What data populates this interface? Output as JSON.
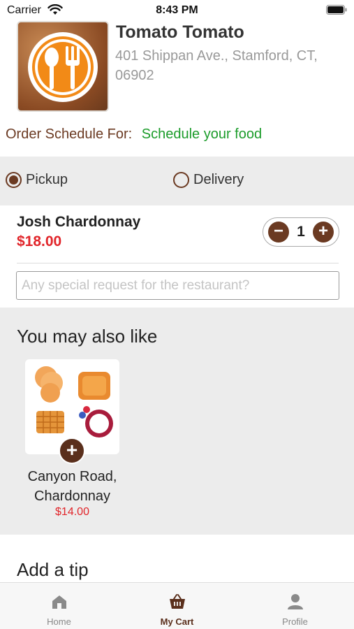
{
  "status_bar": {
    "carrier": "Carrier",
    "time": "8:43 PM"
  },
  "restaurant": {
    "name": "Tomato Tomato",
    "address": "401 Shippan Ave., Stamford, CT, 06902"
  },
  "schedule": {
    "label": "Order Schedule For:",
    "link": "Schedule your food"
  },
  "order_type": {
    "options": [
      {
        "label": "Pickup",
        "selected": true
      },
      {
        "label": "Delivery",
        "selected": false
      }
    ]
  },
  "cart_item": {
    "name": "Josh Chardonnay",
    "price": "$18.00",
    "quantity": "1",
    "request_placeholder": "Any special request for the restaurant?",
    "request_value": ""
  },
  "suggestions": {
    "title": "You may also like",
    "items": [
      {
        "name": "Canyon Road, Chardonnay",
        "price": "$14.00"
      }
    ]
  },
  "tip": {
    "title": "Add a tip"
  },
  "tabs": [
    {
      "label": "Home",
      "icon": "home-icon",
      "active": false
    },
    {
      "label": "My Cart",
      "icon": "basket-icon",
      "active": true
    },
    {
      "label": "Profile",
      "icon": "person-icon",
      "active": false
    }
  ],
  "colors": {
    "brand": "#6b3a22",
    "price": "#e1252a",
    "link": "#1b9c2a",
    "section_bg": "#ececec"
  }
}
